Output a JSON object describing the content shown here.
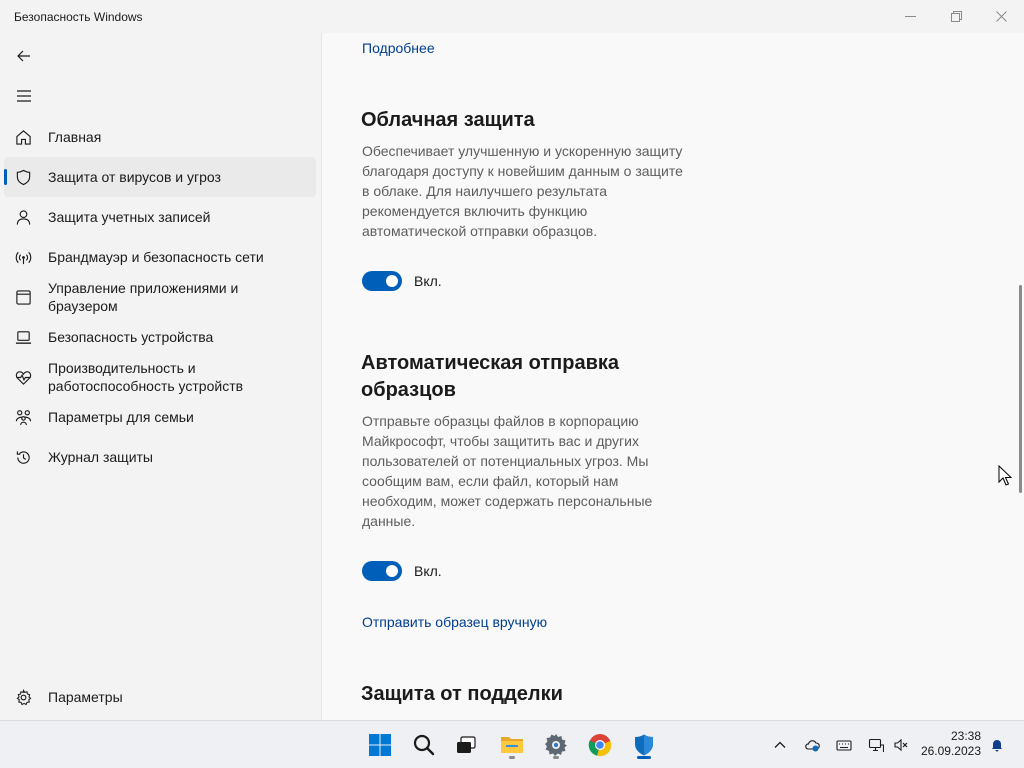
{
  "window": {
    "title": "Безопасность Windows"
  },
  "sidebar": {
    "items": [
      {
        "label": "Главная",
        "icon": "home-icon"
      },
      {
        "label": "Защита от вирусов и угроз",
        "icon": "shield-icon",
        "active": true
      },
      {
        "label": "Защита учетных записей",
        "icon": "person-icon"
      },
      {
        "label": "Брандмауэр и безопасность сети",
        "icon": "wireless-icon"
      },
      {
        "label": "Управление приложениями и браузером",
        "icon": "app-window-icon"
      },
      {
        "label": "Безопасность устройства",
        "icon": "laptop-icon"
      },
      {
        "label": "Производительность и работоспособность устройств",
        "icon": "heart-pulse-icon"
      },
      {
        "label": "Параметры для семьи",
        "icon": "family-icon"
      },
      {
        "label": "Журнал защиты",
        "icon": "history-icon"
      }
    ],
    "settings_label": "Параметры"
  },
  "content": {
    "more_link": "Подробнее",
    "cloud": {
      "title": "Облачная защита",
      "description": "Обеспечивает улучшенную и ускоренную защиту благодаря доступу к новейшим данным о защите в облаке. Для наилучшего результата рекомендуется включить функцию автоматической отправки образцов.",
      "toggle_label": "Вкл.",
      "enabled": true
    },
    "samples": {
      "title": "Автоматическая отправка образцов",
      "description": "Отправьте образцы файлов в корпорацию Майкрософт, чтобы защитить вас и других пользователей от потенциальных угроз. Мы сообщим вам, если файл, который нам необходим, может содержать персональные данные.",
      "toggle_label": "Вкл.",
      "enabled": true,
      "manual_link": "Отправить образец вручную"
    },
    "tamper": {
      "title": "Защита от подделки"
    }
  },
  "taskbar": {
    "apps": [
      "windows-start-icon",
      "search-icon",
      "task-view-icon",
      "file-explorer-icon",
      "settings-gear-icon",
      "chrome-icon",
      "windows-security-icon"
    ],
    "time": "23:38",
    "date": "26.09.2023"
  },
  "colors": {
    "accent": "#005fb8",
    "link": "#003e92"
  }
}
